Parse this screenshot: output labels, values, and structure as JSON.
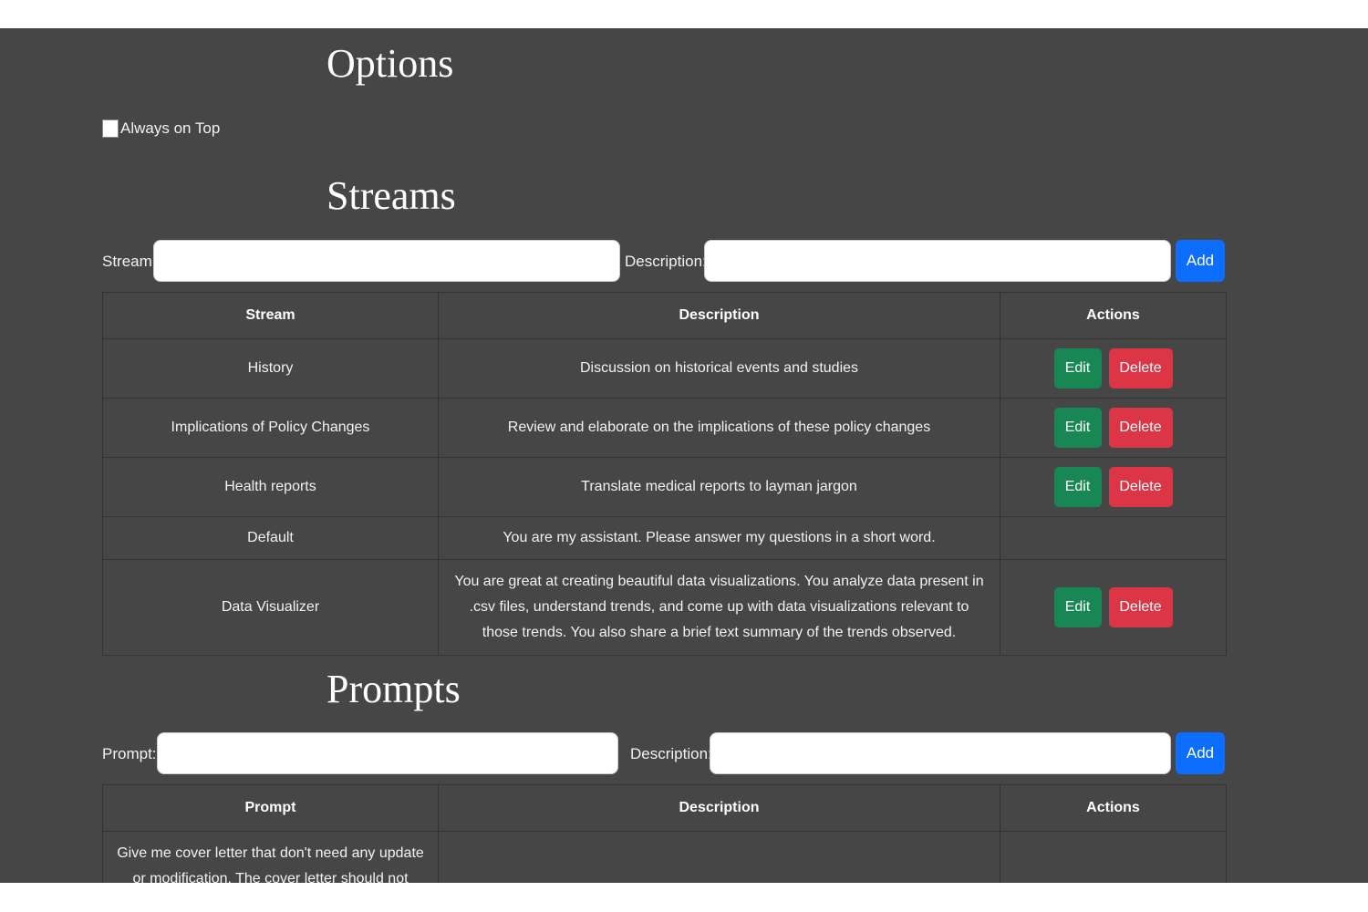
{
  "options": {
    "title": "Options",
    "always_on_top_label": "Always on Top"
  },
  "streams": {
    "title": "Streams",
    "stream_label": "Stream:",
    "description_label": "Description:",
    "stream_input_value": "",
    "description_input_value": "",
    "add_label": "Add",
    "columns": [
      "Stream",
      "Description",
      "Actions"
    ],
    "edit_label": "Edit",
    "delete_label": "Delete",
    "rows": [
      {
        "stream": "History",
        "description": "Discussion on historical events and studies",
        "has_actions": true
      },
      {
        "stream": "Implications of Policy Changes",
        "description": "Review and elaborate on the implications of these policy changes",
        "has_actions": true
      },
      {
        "stream": "Health reports",
        "description": "Translate medical reports to layman jargon",
        "has_actions": true
      },
      {
        "stream": "Default",
        "description": "You are my assistant. Please answer my questions in a short word.",
        "has_actions": false
      },
      {
        "stream": "Data Visualizer",
        "description": "You are great at creating beautiful data visualizations. You analyze data present in .csv files, understand trends, and come up with data visualizations relevant to those trends. You also share a brief text summary of the trends observed.",
        "has_actions": true
      }
    ]
  },
  "prompts": {
    "title": "Prompts",
    "prompt_label": "Prompt:",
    "description_label": "Description:",
    "prompt_input_value": "",
    "description_input_value": "",
    "add_label": "Add",
    "columns": [
      "Prompt",
      "Description",
      "Actions"
    ],
    "rows": [
      {
        "prompt": "Give me cover letter that don't need any update or modification. The cover letter should not include",
        "description": ""
      }
    ]
  },
  "colors": {
    "background": "#464646",
    "add_button": "#0d6efd",
    "edit_button": "#198754",
    "delete_button": "#dc3545"
  }
}
